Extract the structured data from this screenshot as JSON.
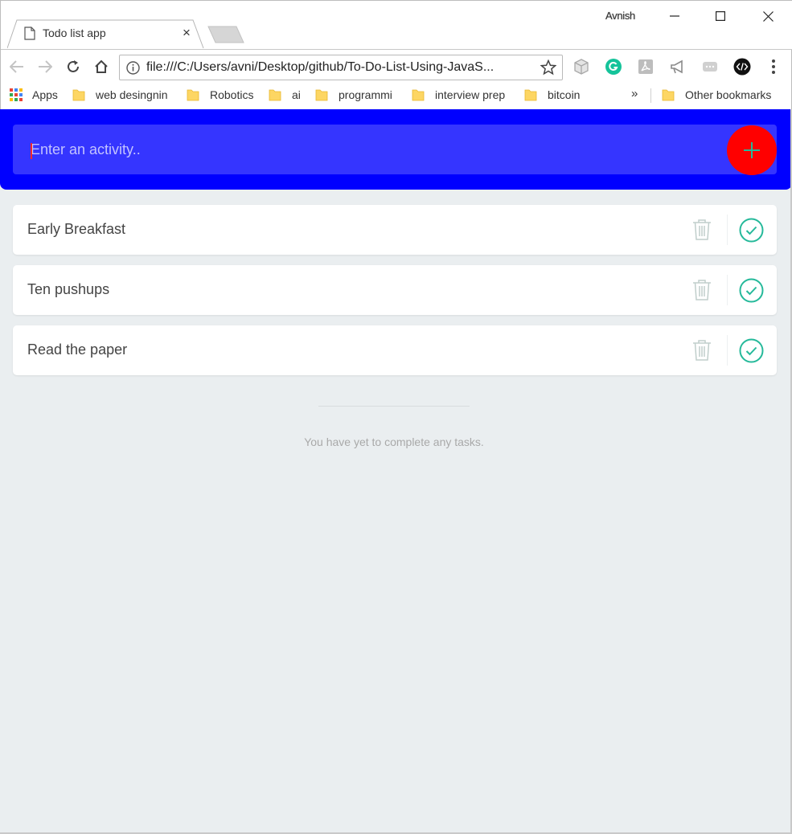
{
  "browser": {
    "tab_title": "Todo list app",
    "tab_close": "×",
    "profile_name": "Avnish",
    "url": "file:///C:/Users/avni/Desktop/github/To-Do-List-Using-JavaS...",
    "bookmarks": {
      "apps": "Apps",
      "items": [
        "web desingnin",
        "Robotics",
        "ai",
        "programmi",
        "interview prep",
        "bitcoin"
      ],
      "overflow": "»",
      "other": "Other bookmarks"
    }
  },
  "app": {
    "input_placeholder": "Enter an activity..",
    "todos": [
      "Early Breakfast",
      "Ten pushups",
      "Read the paper"
    ],
    "completed_empty_message": "You have yet to complete any tasks.",
    "colors": {
      "header": "#0000ff",
      "input": "#3535ff",
      "add_button": "#ff0000",
      "check": "#25b99a",
      "trash": "#c0cecb",
      "background": "#eaeef0"
    }
  }
}
